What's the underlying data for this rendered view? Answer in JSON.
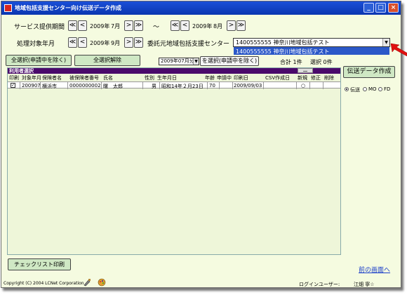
{
  "window": {
    "title": "地域包括支援センター向け伝送データ作成",
    "min_label": "_",
    "max_label": "□",
    "close_label": "×"
  },
  "period": {
    "label": "サービス提供期間",
    "from_year": "2009年",
    "from_month": "7月",
    "to_year": "2009年",
    "to_month": "8月",
    "tilde": "～",
    "first": "≪",
    "prev": "<",
    "next": ">",
    "last": "≫"
  },
  "target": {
    "label": "処理対象年月",
    "year": "2009年",
    "month": "9月"
  },
  "consignor": {
    "label": "委託元地域包括支援センター",
    "selected": "1400555555  神奈川地域包括テスト",
    "option_highlight": "1400555555  神奈川地域包括テスト",
    "arrow": "▼"
  },
  "buttons": {
    "select_all": "全選択(申請中を除く)",
    "deselect_all": "全選択解除",
    "select_by_month": "を選択(申請中を除く)",
    "create_transmission": "伝送データ作成",
    "checklist_print": "チェックリスト印刷"
  },
  "month_filter": {
    "value": "2009年07月分",
    "arrow": "▼"
  },
  "totals": {
    "total": "合計 1件",
    "selected": "選択 0件"
  },
  "grid": {
    "header": "利用者選択",
    "header_btn": "…",
    "columns": [
      "印刷",
      "対象年月",
      "保険者名",
      "被保険者番号",
      "氏名",
      "性別",
      "生年月日",
      "年齢",
      "申請中",
      "印刷日",
      "CSV作成日",
      "新規",
      "修正",
      "削除"
    ],
    "rows": [
      {
        "print": "✓",
        "target_month": "200907",
        "insurer": "横浜市",
        "insured_no": "0000000002",
        "name": "曙　太郎",
        "sex": "男",
        "birth": "昭和14年２月23日",
        "age": "70",
        "applying": "",
        "print_date": "2009/09/03",
        "csv_date": "",
        "new": "○",
        "modify": "",
        "delete": ""
      }
    ]
  },
  "transmission": {
    "options": [
      "伝送",
      "MO",
      "FD"
    ],
    "selected": "伝送"
  },
  "footer": {
    "copyright": "Copyright (C) 2004 LCNet Corporation",
    "back_link": "前の画面へ",
    "login_label": "ログインユーザー:",
    "login_user": "江畑 寧☆"
  },
  "colors": {
    "titlebar": "#0a36b0",
    "window_bg": "#f5fbe0",
    "button_green": "#cfe8c4",
    "grid_header": "#4a0a6b",
    "selection": "#2b58c8",
    "pointer_arrow": "#e01010"
  },
  "icons": [
    "app-icon",
    "red-arrow-pointer-icon",
    "tool-icon",
    "palette-icon"
  ]
}
